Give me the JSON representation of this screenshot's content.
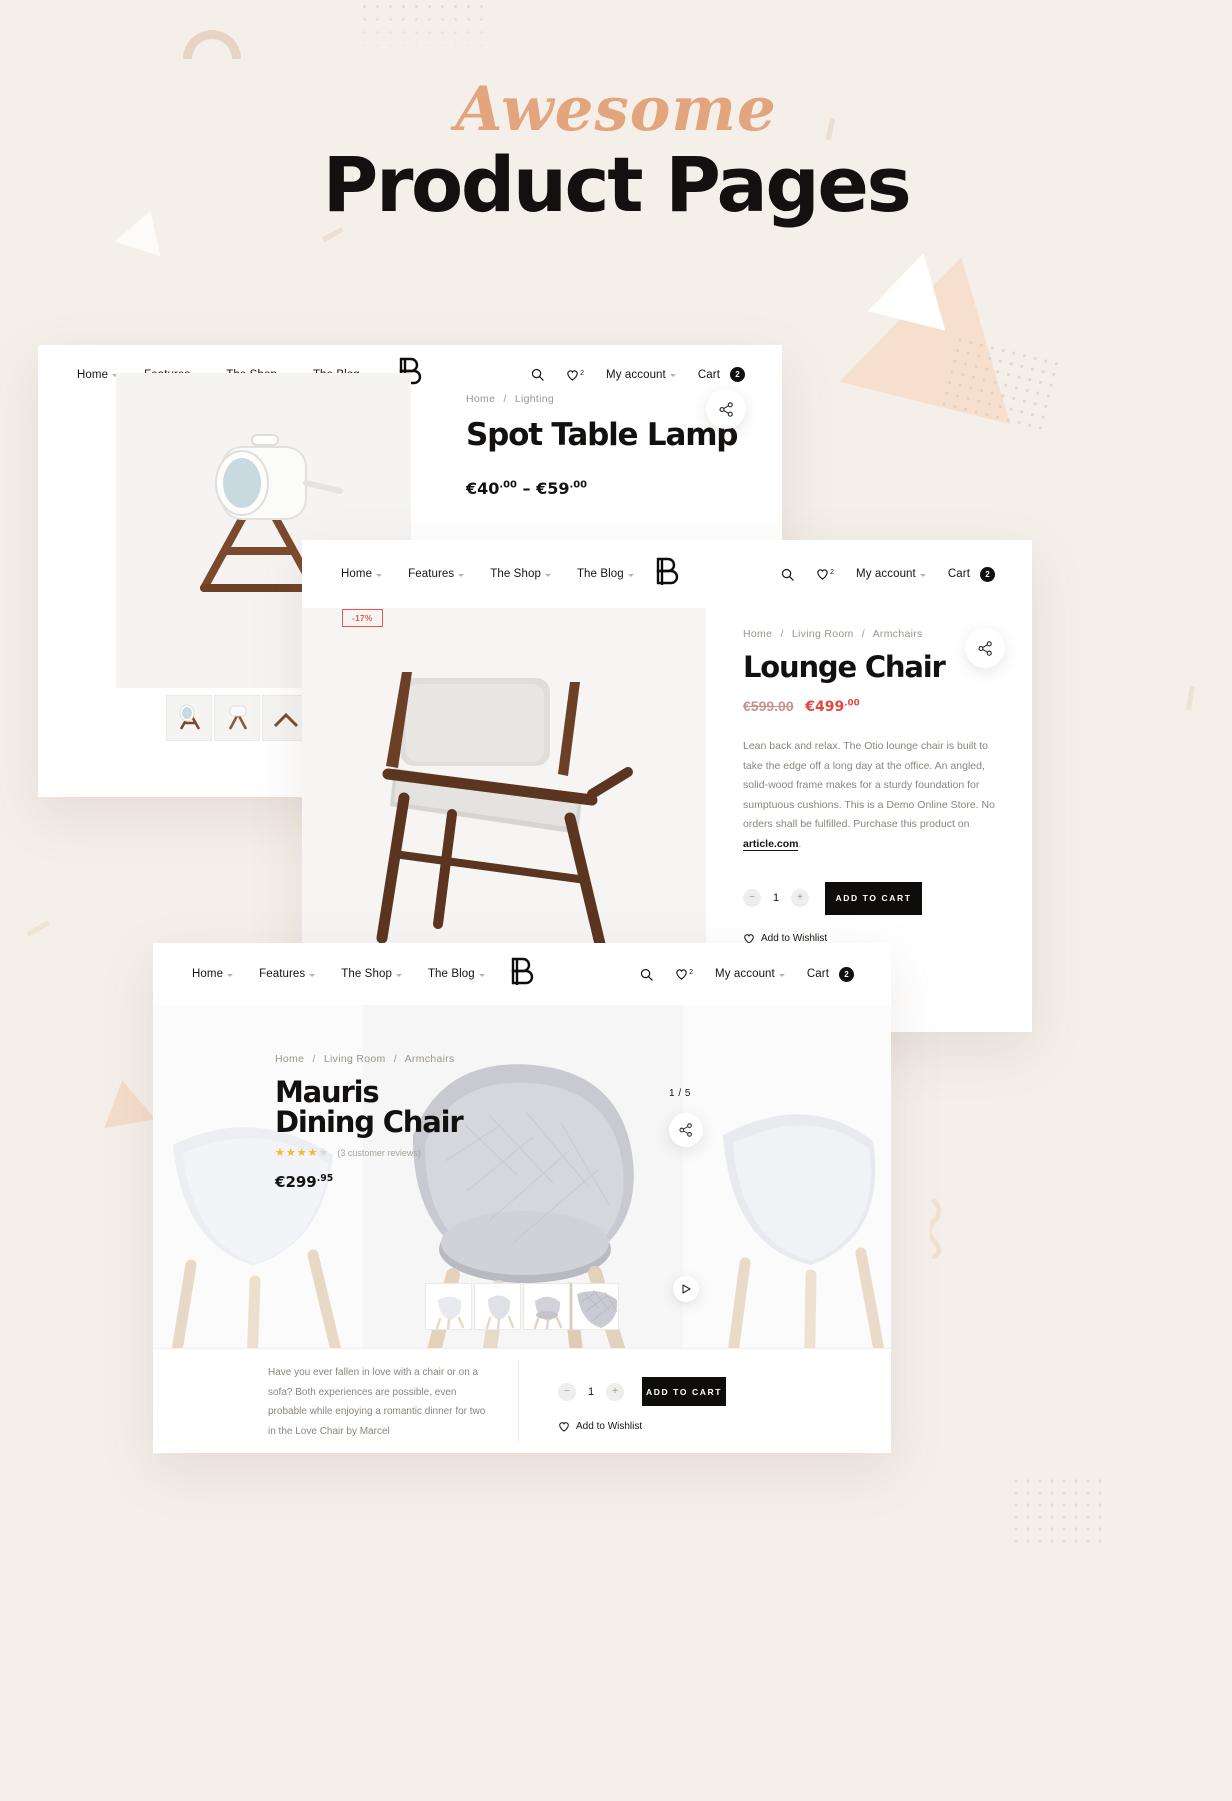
{
  "hero": {
    "script_word": "Awesome",
    "title": "Product Pages"
  },
  "nav": {
    "items": [
      "Home",
      "Features",
      "The Shop",
      "The Blog"
    ],
    "account_label": "My account",
    "cart_label": "Cart",
    "cart_count": "2",
    "wishlist_count": "2",
    "search_icon": "search-icon",
    "heart_icon": "heart-icon",
    "logo": "brand-logo-b"
  },
  "card1": {
    "breadcrumb": [
      "Home",
      "Lighting"
    ],
    "title": "Spot Table Lamp",
    "price_from_currency": "€",
    "price_from_main": "40",
    "price_from_cents": ".00",
    "price_sep": "–",
    "price_to_currency": "€",
    "price_to_main": "59",
    "price_to_cents": ".00",
    "share_icon": "share-icon",
    "thumbs": [
      "lamp-thumb-1",
      "lamp-thumb-2",
      "lamp-thumb-3"
    ]
  },
  "card2": {
    "discount_badge": "-17%",
    "breadcrumb": [
      "Home",
      "Living Room",
      "Armchairs"
    ],
    "title": "Lounge Chair",
    "price_old": "€599.00",
    "price_new_currency": "€",
    "price_new_main": "499",
    "price_new_cents": ".00",
    "description_part1": "Lean back and relax. The Otio lounge chair is built to take the edge off a long day at the office. An angled, solid-wood frame makes for a sturdy foundation for sumptuous cushions. This is a Demo Online Store. No orders shall be fulfilled. Purchase this product on ",
    "description_link": "article.com",
    "description_part2": ".",
    "qty_minus": "−",
    "qty_value": "1",
    "qty_plus": "+",
    "add_to_cart": "ADD TO CART",
    "wishlist": "Add to Wishlist",
    "share_icon": "share-icon"
  },
  "card3": {
    "breadcrumb": [
      "Home",
      "Living Room",
      "Armchairs"
    ],
    "title_line1": "Mauris",
    "title_line2": "Dining Chair",
    "rating": 3.5,
    "reviews": "(3 customer reviews)",
    "price_currency": "€",
    "price_main": "299",
    "price_cents": ".95",
    "counter": "1 / 5",
    "share_icon": "share-icon",
    "next_icon": "play-next-icon",
    "thumbs": [
      "chair-thumb-1",
      "chair-thumb-2",
      "chair-thumb-3",
      "chair-thumb-4"
    ],
    "bottom_description": "Have you ever fallen in love with a chair or on a sofa? Both experiences are possible, even probable while enjoying a romantic dinner for two in the Love Chair by Marcel",
    "qty_minus": "−",
    "qty_value": "1",
    "qty_plus": "+",
    "add_to_cart": "ADD TO CART",
    "wishlist": "Add to Wishlist"
  },
  "colors": {
    "background": "#f4efe9",
    "accent_peach": "#e2a57d",
    "sale_red": "#e8453c",
    "ink": "#131110",
    "muted": "#8b857e",
    "star": "#ffb425"
  }
}
